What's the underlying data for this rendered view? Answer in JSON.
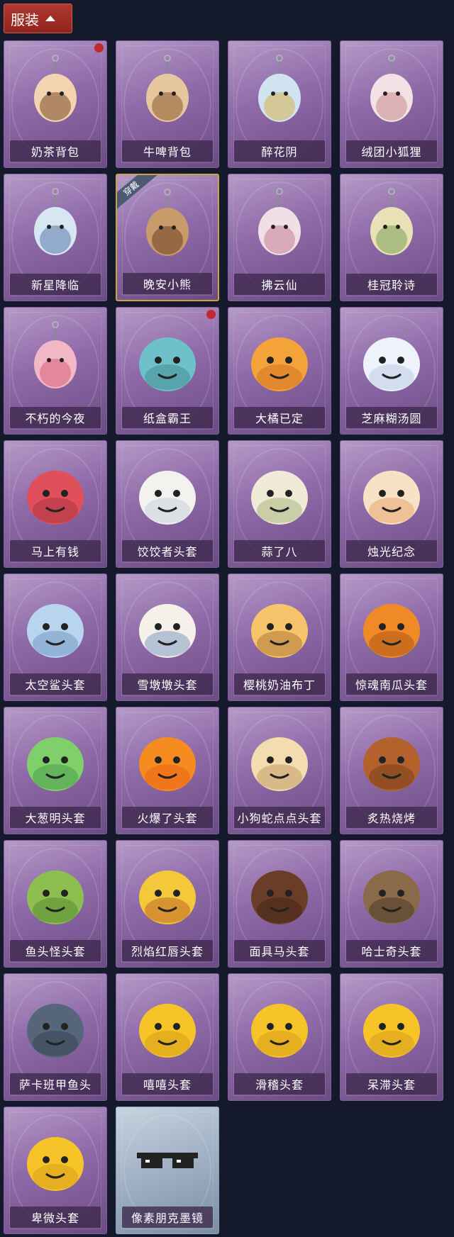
{
  "header": {
    "label": "服装"
  },
  "equipped_badge": "穿戴",
  "items": [
    {
      "name": "奶茶背包",
      "icon": "milk-tea-backpack-icon",
      "dot": true,
      "kind": "bag"
    },
    {
      "name": "牛啤背包",
      "icon": "cow-beer-backpack-icon",
      "kind": "bag"
    },
    {
      "name": "醉花阴",
      "icon": "flower-dreamcatcher-icon",
      "kind": "charm"
    },
    {
      "name": "绒团小狐狸",
      "icon": "fox-charm-icon",
      "kind": "charm"
    },
    {
      "name": "新星降临",
      "icon": "star-boy-charm-icon",
      "kind": "charm"
    },
    {
      "name": "晚安小熊",
      "icon": "teddy-bear-charm-icon",
      "equipped": true,
      "kind": "charm"
    },
    {
      "name": "拂云仙",
      "icon": "cloud-fairy-charm-icon",
      "kind": "charm"
    },
    {
      "name": "桂冠聆诗",
      "icon": "laurel-poet-charm-icon",
      "kind": "charm"
    },
    {
      "name": "不朽的今夜",
      "icon": "fox-bowl-icon",
      "kind": "charm"
    },
    {
      "name": "纸盒霸王",
      "icon": "cardboard-dino-icon",
      "dot": true,
      "kind": "head"
    },
    {
      "name": "大橘已定",
      "icon": "orange-slice-icon",
      "kind": "head"
    },
    {
      "name": "芝麻糊汤圆",
      "icon": "rice-ball-icon",
      "kind": "head"
    },
    {
      "name": "马上有钱",
      "icon": "horse-head-icon",
      "kind": "head"
    },
    {
      "name": "饺饺者头套",
      "icon": "dumpling-head-icon",
      "kind": "head"
    },
    {
      "name": "蒜了八",
      "icon": "garlic-head-icon",
      "kind": "head"
    },
    {
      "name": "烛光纪念",
      "icon": "candle-head-icon",
      "kind": "head"
    },
    {
      "name": "太空鲨头套",
      "icon": "space-shark-head-icon",
      "kind": "head"
    },
    {
      "name": "雪墩墩头套",
      "icon": "snowman-head-icon",
      "kind": "head"
    },
    {
      "name": "樱桃奶油布丁",
      "icon": "pudding-head-icon",
      "kind": "head"
    },
    {
      "name": "惊魂南瓜头套",
      "icon": "pumpkin-head-icon",
      "kind": "head"
    },
    {
      "name": "大葱明头套",
      "icon": "scallion-head-icon",
      "kind": "head"
    },
    {
      "name": "火爆了头套",
      "icon": "fire-head-icon",
      "kind": "head"
    },
    {
      "name": "小狗蛇点点头套",
      "icon": "dog-snake-head-icon",
      "kind": "head"
    },
    {
      "name": "炙热烧烤",
      "icon": "bbq-head-icon",
      "kind": "head"
    },
    {
      "name": "鱼头怪头套",
      "icon": "fish-head-icon",
      "kind": "head"
    },
    {
      "name": "烈焰红唇头套",
      "icon": "red-lips-head-icon",
      "kind": "head"
    },
    {
      "name": "面具马头套",
      "icon": "horse-mask-head-icon",
      "kind": "head"
    },
    {
      "name": "哈士奇头套",
      "icon": "husky-head-icon",
      "kind": "head"
    },
    {
      "name": "萨卡班甲鱼头",
      "icon": "sacabambaspis-head-icon",
      "kind": "head"
    },
    {
      "name": "嘻嘻头套",
      "icon": "grin-emoji-head-icon",
      "kind": "head"
    },
    {
      "name": "滑稽头套",
      "icon": "funny-emoji-head-icon",
      "kind": "head"
    },
    {
      "name": "呆滞头套",
      "icon": "dazed-emoji-head-icon",
      "kind": "head"
    },
    {
      "name": "卑微头套",
      "icon": "humble-emoji-head-icon",
      "kind": "head"
    },
    {
      "name": "像素朋克墨镜",
      "icon": "pixel-sunglasses-icon",
      "special": true,
      "kind": "glasses"
    }
  ],
  "colors": {
    "background": "#141a2c",
    "card": "#8f6aa8",
    "card_special": "#9fb0c4",
    "header": "#a0302a",
    "dot": "#c4282f",
    "equipped_border": "#cba24a"
  }
}
